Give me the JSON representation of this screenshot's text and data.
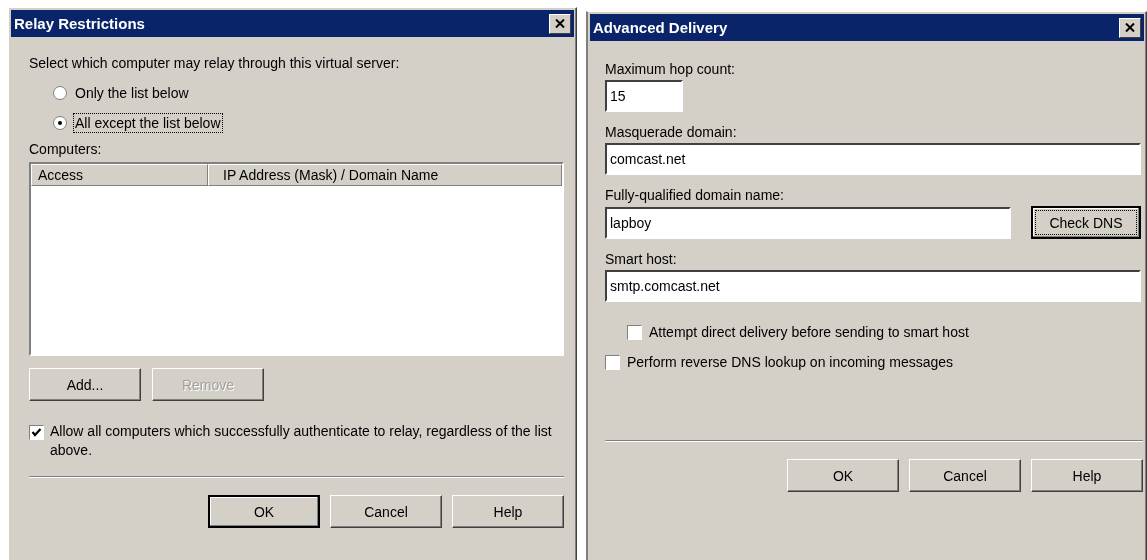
{
  "relay_dialog": {
    "title": "Relay Restrictions",
    "prompt": "Select which computer may relay through this virtual server:",
    "options": [
      {
        "label": "Only the list below",
        "selected": false,
        "focused": false
      },
      {
        "label": "All except the list below",
        "selected": true,
        "focused": true
      }
    ],
    "computers_label": "Computers:",
    "list": {
      "columns": [
        "Access",
        "IP Address (Mask) / Domain Name"
      ]
    },
    "list_buttons": [
      {
        "label": "Add...",
        "disabled": false
      },
      {
        "label": "Remove",
        "disabled": true
      }
    ],
    "authenticate": {
      "label": "Allow all computers which successfully authenticate to relay, regardless of the list above.",
      "checked": true
    },
    "buttons": [
      {
        "label": "OK",
        "default": true
      },
      {
        "label": "Cancel",
        "default": false
      },
      {
        "label": "Help",
        "default": false
      }
    ]
  },
  "delivery_dialog": {
    "title": "Advanced Delivery",
    "fields": [
      {
        "kind": "short",
        "label": "Maximum hop count:",
        "value": "15"
      },
      {
        "kind": "full",
        "label": "Masquerade domain:",
        "value": "comcast.net"
      },
      {
        "kind": "with_button",
        "label": "Fully-qualified domain name:",
        "value": "lapboy",
        "button": {
          "label": "Check DNS",
          "default": true,
          "focused": true
        }
      },
      {
        "kind": "full",
        "label": "Smart host:",
        "value": "smtp.comcast.net"
      }
    ],
    "checkboxes": [
      {
        "kind": "sub",
        "label": "Attempt direct delivery before sending to smart host",
        "checked": false
      },
      {
        "kind": "top",
        "label": "Perform reverse DNS lookup on incoming messages",
        "checked": false
      }
    ],
    "buttons": [
      {
        "label": "OK",
        "default": false
      },
      {
        "label": "Cancel",
        "default": false
      },
      {
        "label": "Help",
        "default": false
      }
    ]
  }
}
